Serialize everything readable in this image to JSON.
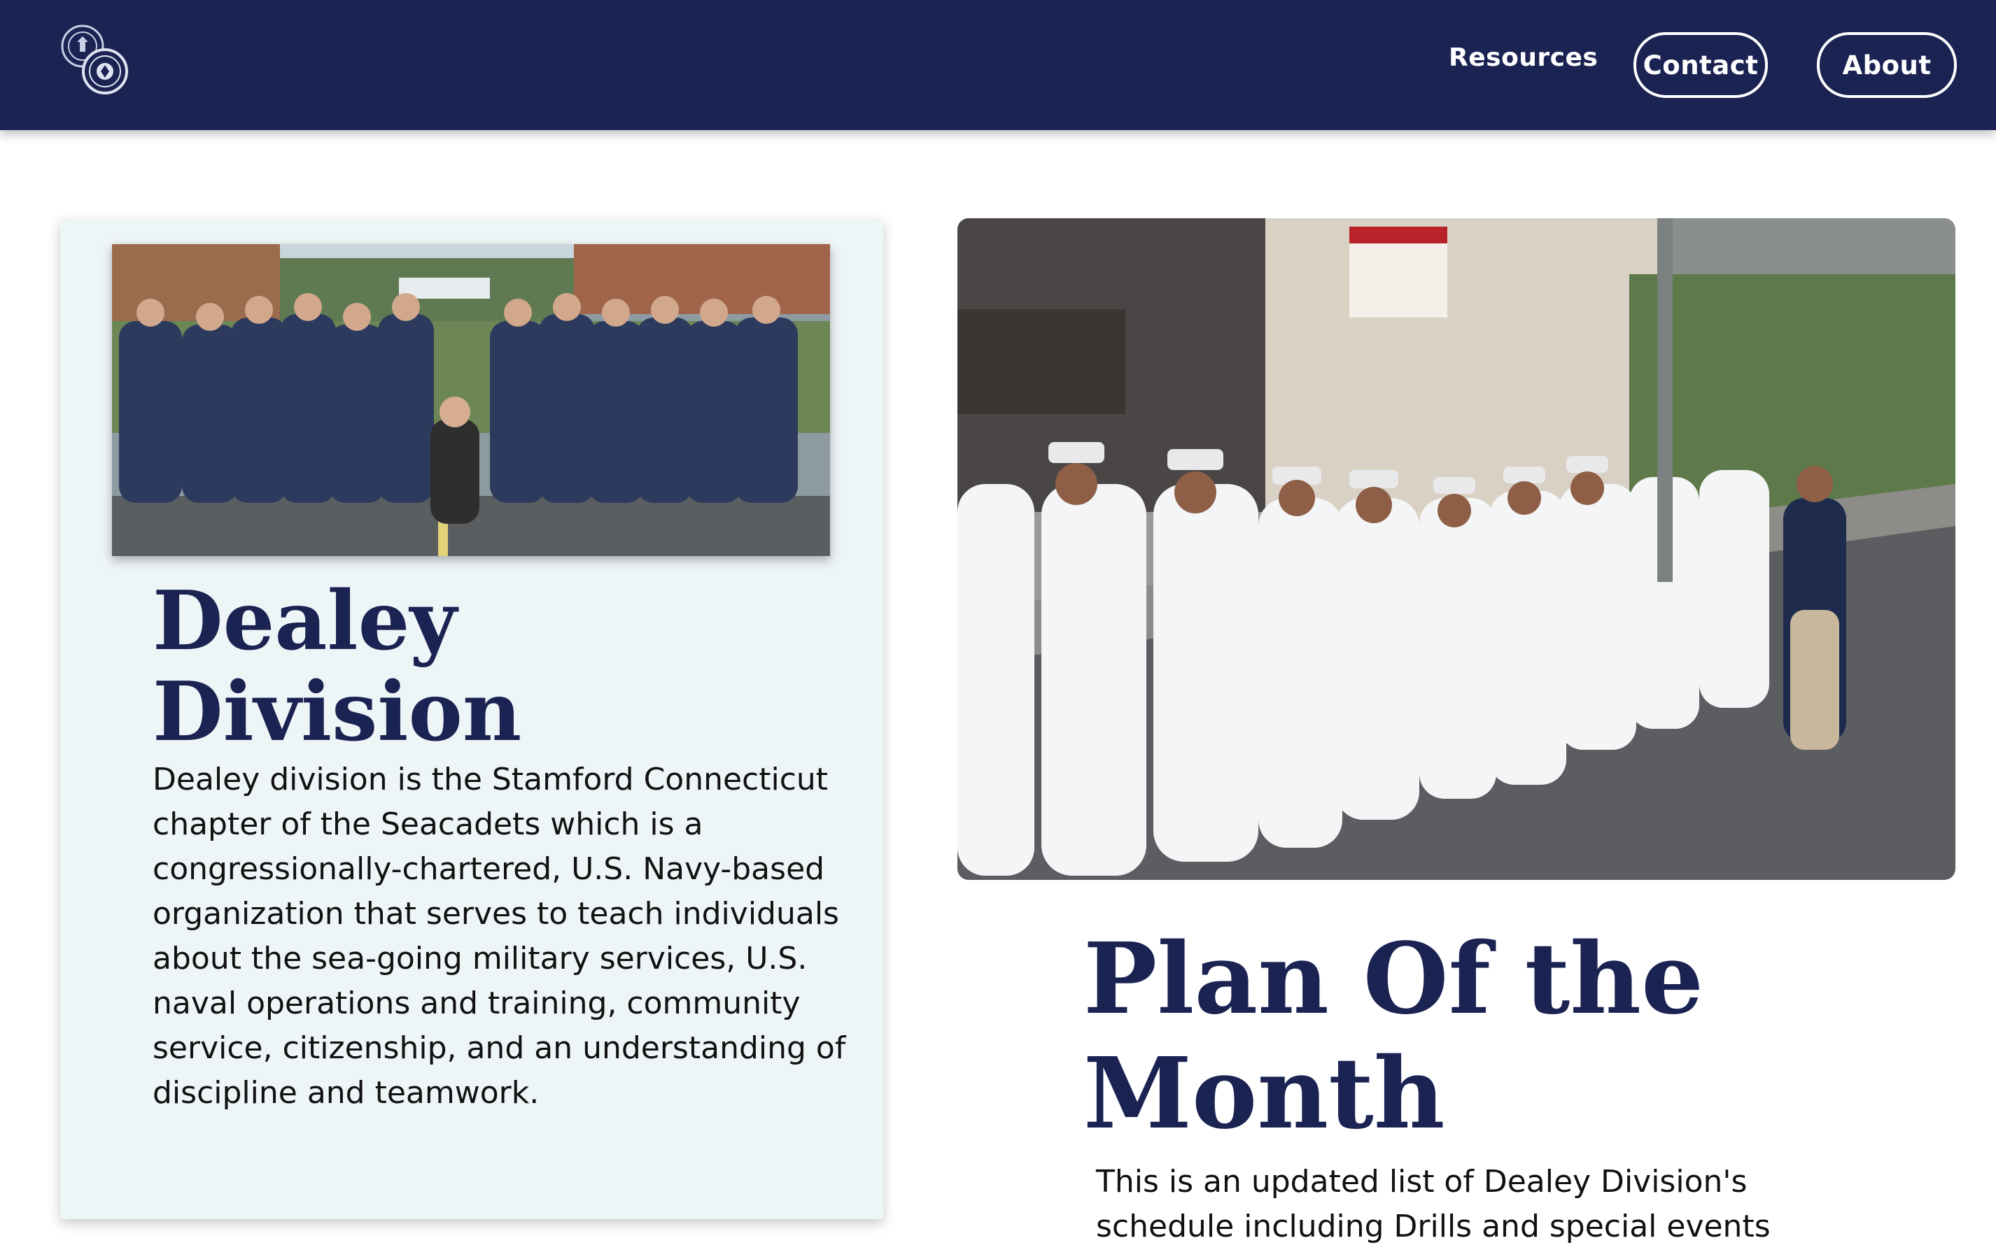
{
  "header": {
    "logo_icon": "seacadets-seal-icon",
    "nav": {
      "resources": "Resources",
      "contact": "Contact",
      "about": "About"
    },
    "background_color": "#1b2353"
  },
  "intro_card": {
    "photo_icon": "group-photo-cadets",
    "title": "Dealey Division",
    "body": "Dealey division is the Stamford Connecticut chapter of the Seacadets which is a congressionally-chartered, U.S. Navy-based organization that serves to teach individuals about the sea-going military services, U.S. naval operations and training, community service, citizenship, and an understanding of discipline and teamwork.",
    "background_color": "#eef5f7"
  },
  "plan_section": {
    "photo_icon": "parade-photo-cadets",
    "title": "Plan Of the Month",
    "body": "This is an updated list of Dealey Division's schedule including Drills and special events"
  },
  "colors": {
    "navy": "#1b2353",
    "text": "#111111"
  }
}
